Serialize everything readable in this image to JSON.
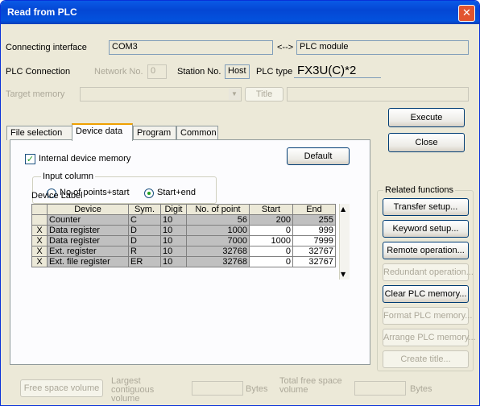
{
  "window": {
    "title": "Read from PLC",
    "close_glyph": "✕"
  },
  "conn": {
    "label": "Connecting interface",
    "value": "COM3",
    "arrow": "<-->",
    "target": "PLC module"
  },
  "plcconn": {
    "label": "PLC Connection",
    "network_label": "Network No.",
    "network_value": "0",
    "station_label": "Station No.",
    "station_value": "Host",
    "type_label": "PLC type",
    "type_value": "FX3U(C)*2"
  },
  "target": {
    "label": "Target memory",
    "title_btn": "Title"
  },
  "tabs": [
    "File selection",
    "Device data",
    "Program",
    "Common"
  ],
  "device": {
    "checkbox_label": "Internal device memory",
    "check": "✓",
    "default_btn": "Default",
    "input_column_label": "Input column",
    "radio1": "No.of points+start",
    "radio2": "Start+end",
    "device_label": "Device Label"
  },
  "table": {
    "headers": [
      "Device",
      "Sym.",
      "Digit",
      "No. of point",
      "Start",
      "End"
    ],
    "rows": [
      {
        "mark": "",
        "device": "Counter",
        "sym": "C",
        "digit": "10",
        "points": "56",
        "start": "200",
        "end": "255"
      },
      {
        "mark": "X",
        "device": "Data register",
        "sym": "D",
        "digit": "10",
        "points": "1000",
        "start": "0",
        "end": "999"
      },
      {
        "mark": "X",
        "device": "Data register",
        "sym": "D",
        "digit": "10",
        "points": "7000",
        "start": "1000",
        "end": "7999"
      },
      {
        "mark": "X",
        "device": "Ext. register",
        "sym": "R",
        "digit": "10",
        "points": "32768",
        "start": "0",
        "end": "32767"
      },
      {
        "mark": "X",
        "device": "Ext. file register",
        "sym": "ER",
        "digit": "10",
        "points": "32768",
        "start": "0",
        "end": "32767"
      }
    ]
  },
  "right": {
    "execute": "Execute",
    "close": "Close",
    "related_label": "Related functions",
    "buttons": [
      "Transfer setup...",
      "Keyword setup...",
      "Remote operation...",
      "Redundant operation...",
      "Clear PLC memory...",
      "Format PLC memory...",
      "Arrange PLC memory...",
      "Create title..."
    ]
  },
  "bottom": {
    "free_btn": "Free space volume",
    "largest_label": "Largest contiguous volume",
    "bytes1": "Bytes",
    "total_label": "Total free space volume",
    "bytes2": "Bytes"
  }
}
